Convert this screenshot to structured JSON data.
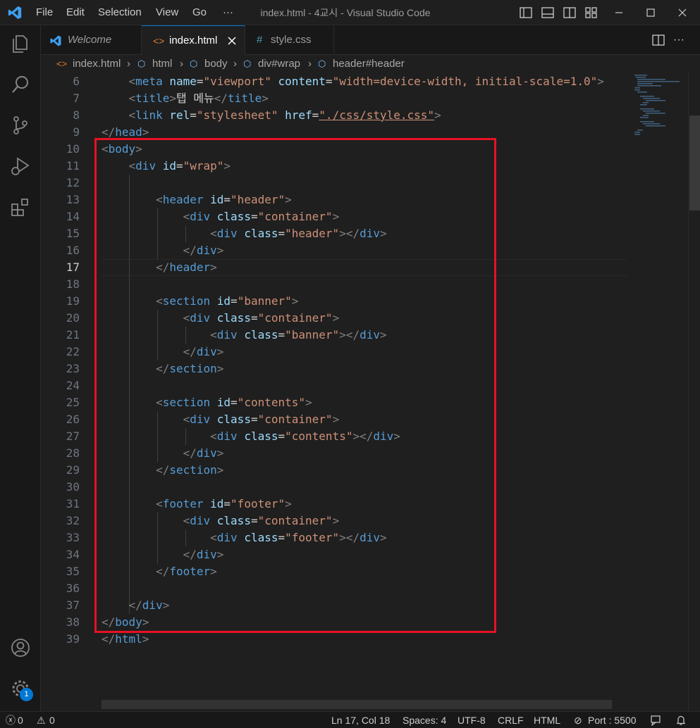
{
  "titlebar": {
    "menus": [
      "File",
      "Edit",
      "Selection",
      "View",
      "Go",
      "···"
    ],
    "title": "index.html - 4교시 - Visual Studio Code"
  },
  "tabs": [
    {
      "label": "Welcome",
      "icon": "vscode-logo-icon",
      "active": false
    },
    {
      "label": "index.html",
      "icon": "html-icon",
      "active": true
    },
    {
      "label": "style.css",
      "icon": "css-hash-icon",
      "active": false
    }
  ],
  "breadcrumb": [
    "index.html",
    "html",
    "body",
    "div#wrap",
    "header#header"
  ],
  "editor": {
    "current_line": 17,
    "line_numbers": [
      "6",
      "7",
      "8",
      "9",
      "10",
      "11",
      "12",
      "13",
      "14",
      "15",
      "16",
      "17",
      "18",
      "19",
      "20",
      "21",
      "22",
      "23",
      "24",
      "25",
      "26",
      "27",
      "28",
      "29",
      "30",
      "31",
      "32",
      "33",
      "34",
      "35",
      "36",
      "37",
      "38",
      "39"
    ],
    "title_text": "탭 메뉴",
    "strings": {
      "viewport": "\"viewport\"",
      "content": "\"width=device-width, initial-scale=1.0\"",
      "stylesheet": "\"stylesheet\"",
      "href": "\"./css/style.css\"",
      "wrap": "\"wrap\"",
      "header": "\"header\"",
      "container": "\"container\"",
      "banner": "\"banner\"",
      "contents": "\"contents\"",
      "footer": "\"footer\""
    }
  },
  "statusbar": {
    "errors": "0",
    "warnings": "0",
    "position": "Ln 17, Col 18",
    "spaces": "Spaces: 4",
    "encoding": "UTF-8",
    "eol": "CRLF",
    "language": "HTML",
    "port": "Port : 5500"
  },
  "notifications": {
    "settings_badge": "1"
  },
  "colors": {
    "accent": "#0078d4",
    "highlight_box": "#e81123",
    "tag": "#569cd6",
    "attr": "#9cdcfe",
    "string": "#ce9178"
  }
}
